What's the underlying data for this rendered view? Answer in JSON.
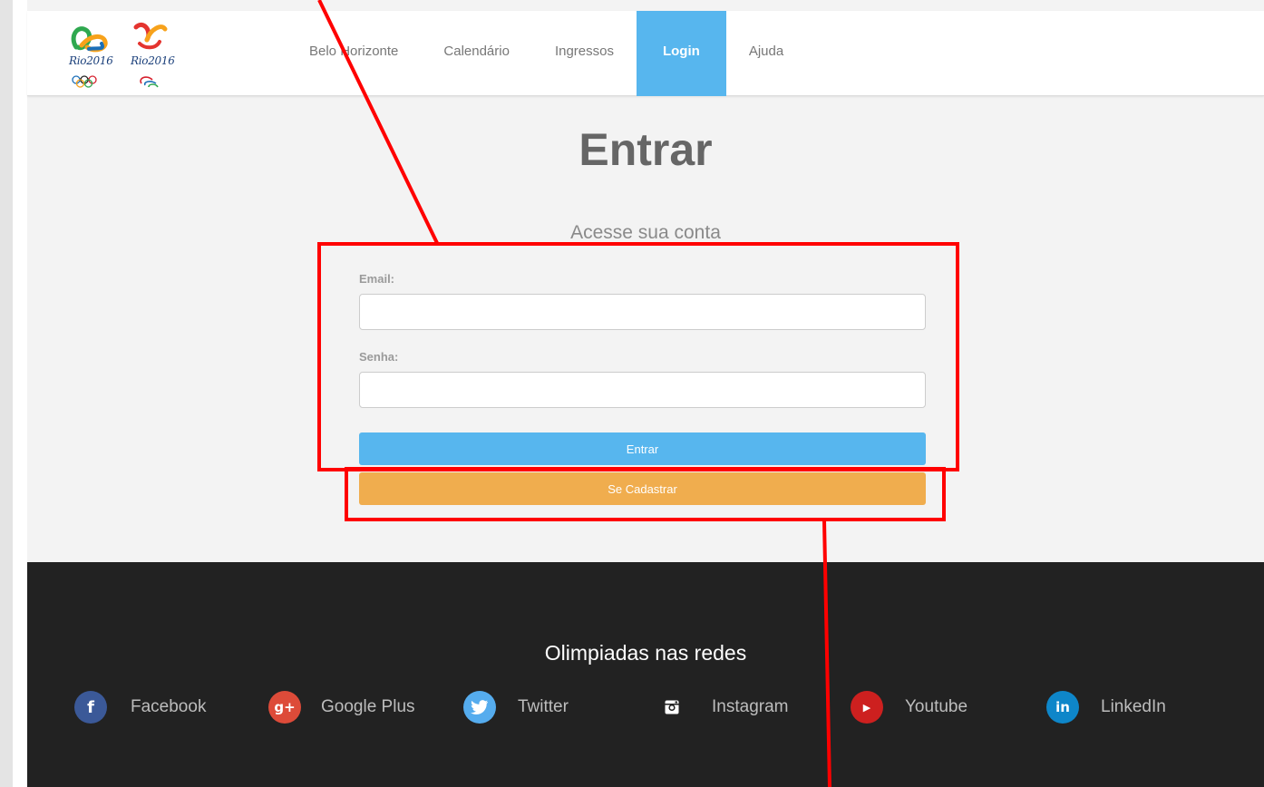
{
  "header": {
    "logos": {
      "olympic": {
        "wordmark": "Rio2016"
      },
      "paralympic": {
        "wordmark": "Rio2016"
      }
    },
    "nav": [
      {
        "label": "Belo Horizonte"
      },
      {
        "label": "Calendário"
      },
      {
        "label": "Ingressos"
      },
      {
        "label": "Login"
      },
      {
        "label": "Ajuda"
      }
    ],
    "active_nav": "Login"
  },
  "main": {
    "title": "Entrar",
    "subtitle": "Acesse sua conta",
    "form": {
      "email_label": "Email:",
      "email_value": "",
      "password_label": "Senha:",
      "password_value": "",
      "submit_label": "Entrar",
      "register_label": "Se Cadastrar"
    }
  },
  "footer": {
    "title": "Olimpiadas nas redes",
    "social": [
      {
        "label": "Facebook",
        "icon": "facebook-icon"
      },
      {
        "label": "Google Plus",
        "icon": "google-plus-icon"
      },
      {
        "label": "Twitter",
        "icon": "twitter-icon"
      },
      {
        "label": "Instagram",
        "icon": "instagram-icon"
      },
      {
        "label": "Youtube",
        "icon": "youtube-icon"
      },
      {
        "label": "LinkedIn",
        "icon": "linkedin-icon"
      }
    ]
  },
  "colors": {
    "accent_blue": "#57b6ee",
    "register_orange": "#f0ad4e",
    "footer_bg": "#222222",
    "annotation_red": "#ff0000",
    "facebook": "#3b5998",
    "google_plus": "#dd4b39",
    "twitter": "#55acee",
    "youtube": "#cd201f",
    "linkedin": "#0e86c9"
  }
}
